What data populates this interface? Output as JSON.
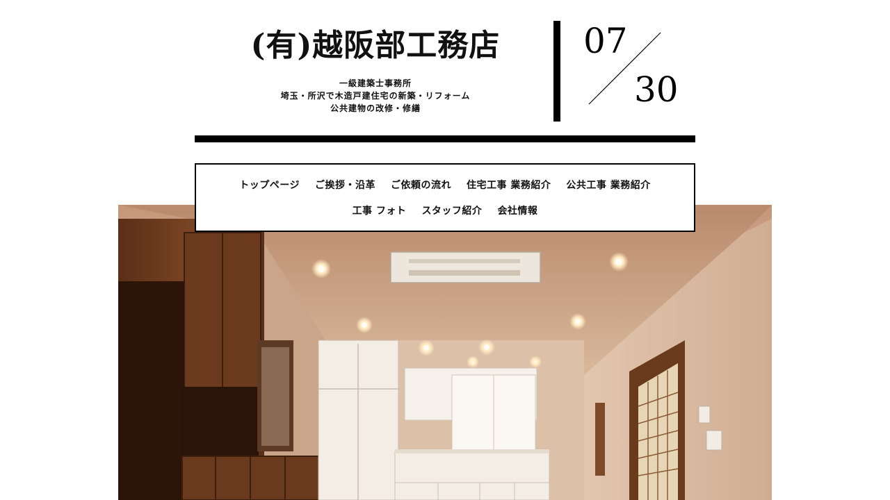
{
  "header": {
    "site_title": "(有)越阪部工務店",
    "tagline": [
      "一級建築士事務所",
      "埼玉・所沢で木造戸建住宅の新築・リフォーム",
      "公共建物の改修・修繕"
    ],
    "date": {
      "month": "07",
      "day": "30"
    }
  },
  "nav": {
    "row1": [
      "トップページ",
      "ご挨拶・沿革",
      "ご依頼の流れ",
      "住宅工事 業務紹介",
      "公共工事 業務紹介"
    ],
    "row2": [
      "工事 フォト",
      "スタッフ紹介",
      "会社情報"
    ]
  },
  "hero": {
    "subject": "interior-photo-dining-kitchen"
  }
}
